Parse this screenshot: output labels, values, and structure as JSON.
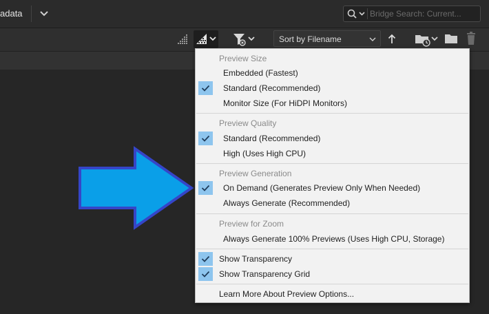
{
  "header": {
    "workspace_label": "adata",
    "search_placeholder": "Bridge Search: Current..."
  },
  "toolbar": {
    "sort_label": "Sort by Filename"
  },
  "menu": {
    "sections": [
      {
        "header": "Preview Size",
        "items": [
          {
            "label": "Embedded (Fastest)",
            "checked": false
          },
          {
            "label": "Standard (Recommended)",
            "checked": true
          },
          {
            "label": "Monitor Size (For HiDPI Monitors)",
            "checked": false
          }
        ]
      },
      {
        "header": "Preview Quality",
        "items": [
          {
            "label": "Standard (Recommended)",
            "checked": true
          },
          {
            "label": "High (Uses High CPU)",
            "checked": false
          }
        ]
      },
      {
        "header": "Preview Generation",
        "items": [
          {
            "label": "On Demand (Generates Preview Only When Needed)",
            "checked": true
          },
          {
            "label": "Always Generate (Recommended)",
            "checked": false
          }
        ]
      },
      {
        "header": "Preview for Zoom",
        "items": [
          {
            "label": "Always Generate 100% Previews (Uses High CPU, Storage)",
            "checked": false
          }
        ]
      }
    ],
    "toggles": [
      {
        "label": "Show Transparency",
        "checked": true
      },
      {
        "label": "Show Transparency Grid",
        "checked": true
      }
    ],
    "learn_more": "Learn More About Preview Options..."
  },
  "colors": {
    "background": "#262626",
    "menu_bg": "#f2f2f2",
    "check_highlight": "#8ec5ee",
    "arrow_fill": "#0a9fe8",
    "arrow_outline": "#3545c8"
  },
  "annotation": {
    "icon": "arrow-right-icon"
  }
}
